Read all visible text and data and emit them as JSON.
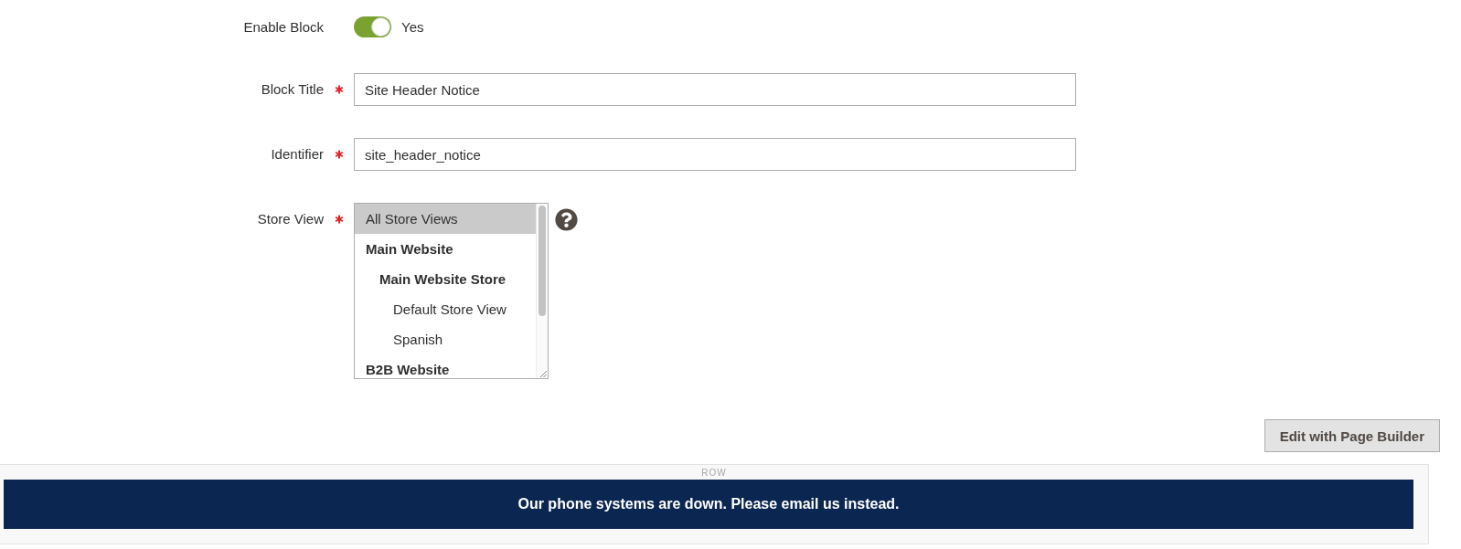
{
  "form": {
    "fields": [
      {
        "kind": "toggle",
        "label": "Enable Block",
        "required": false,
        "on": true,
        "value_label": "Yes"
      },
      {
        "kind": "text",
        "label": "Block Title",
        "required": true,
        "value": "Site Header Notice"
      },
      {
        "kind": "text",
        "label": "Identifier",
        "required": true,
        "value": "site_header_notice"
      },
      {
        "kind": "multiselect",
        "label": "Store View",
        "required": true,
        "help_icon": true,
        "options": [
          {
            "kind": "option",
            "label": "All Store Views",
            "selected": true
          },
          {
            "kind": "group",
            "label": "Main Website",
            "selected": false,
            "children": [
              {
                "kind": "group",
                "label": "Main Website Store",
                "selected": false,
                "children": [
                  {
                    "kind": "option",
                    "label": "Default Store View",
                    "selected": false
                  },
                  {
                    "kind": "option",
                    "label": "Spanish",
                    "selected": false
                  }
                ]
              }
            ]
          },
          {
            "kind": "group",
            "label": "B2B Website",
            "selected": false
          }
        ]
      }
    ]
  },
  "page_builder_button": {
    "label": "Edit with Page Builder"
  },
  "stage": {
    "row_label": "ROW",
    "banner": {
      "text": "Our phone systems are down. Please email us instead."
    }
  }
}
